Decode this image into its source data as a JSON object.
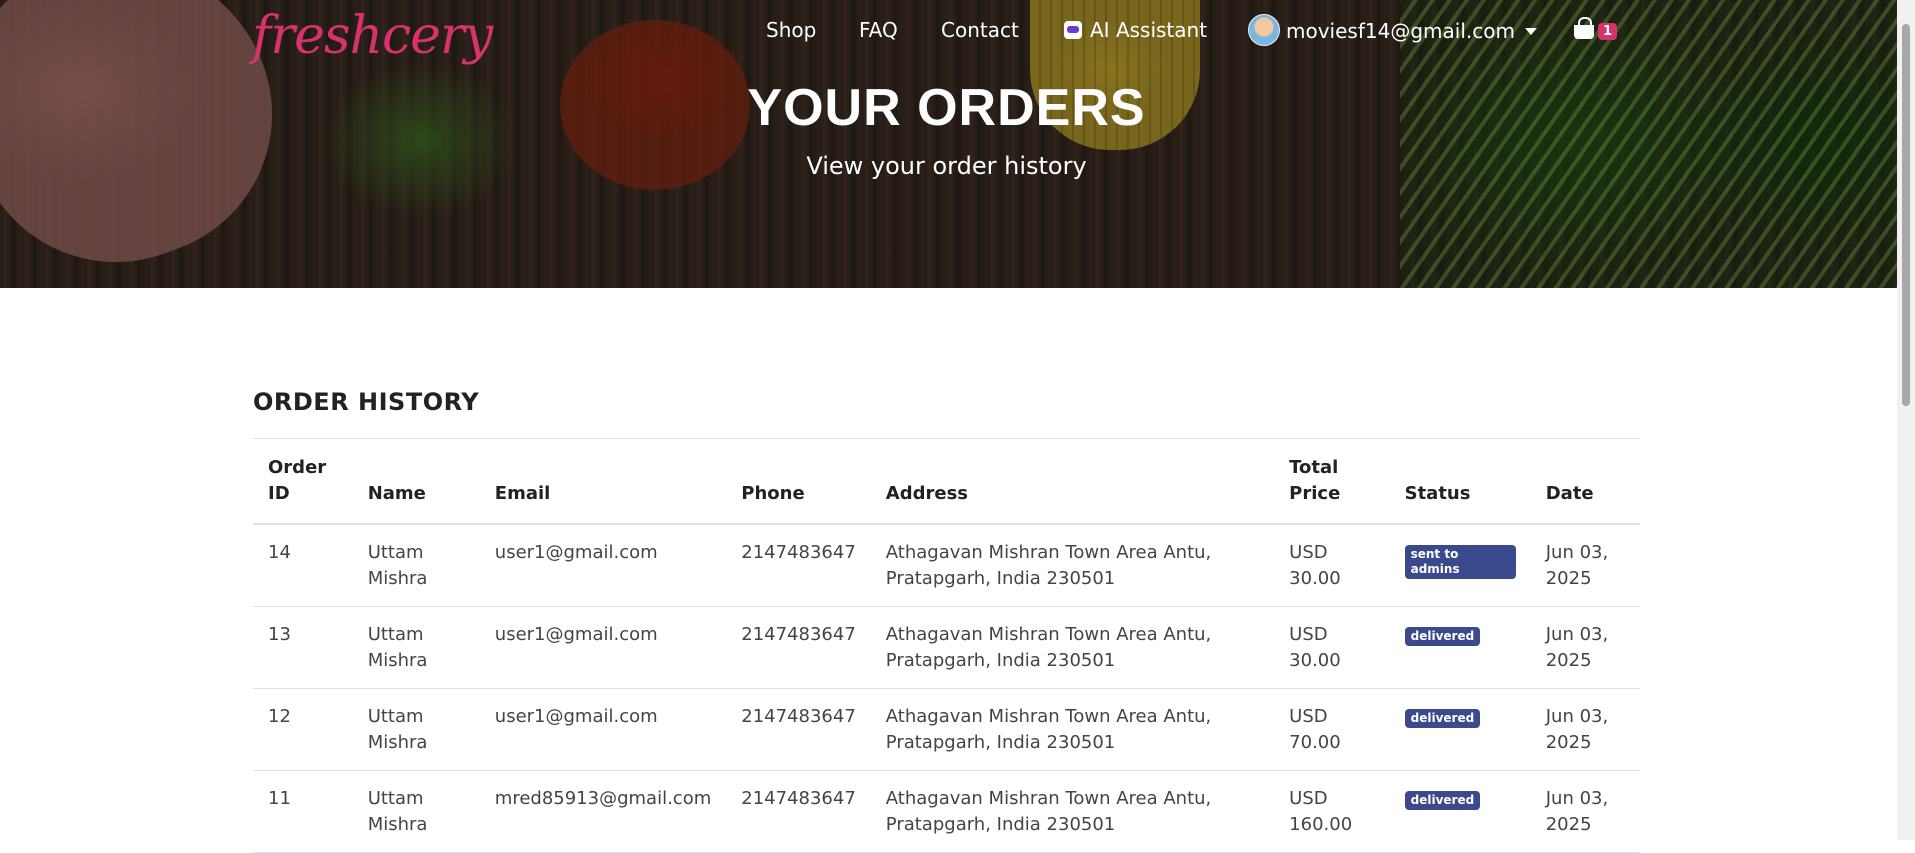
{
  "brand": {
    "logo_text": "freshcery"
  },
  "nav": {
    "shop": "Shop",
    "faq": "FAQ",
    "contact": "Contact",
    "ai_assistant": "AI Assistant",
    "user_email": "moviesf14@gmail.com",
    "cart_count": "1"
  },
  "hero": {
    "title": "YOUR ORDERS",
    "subtitle": "View your order history"
  },
  "orders": {
    "section_title": "ORDER HISTORY",
    "columns": {
      "order_id": "Order ID",
      "name": "Name",
      "email": "Email",
      "phone": "Phone",
      "address": "Address",
      "total_price": "Total Price",
      "status": "Status",
      "date": "Date"
    },
    "rows": [
      {
        "id": "14",
        "name": "Uttam Mishra",
        "email": "user1@gmail.com",
        "phone": "2147483647",
        "address": "Athagavan Mishran Town Area Antu, Pratapgarh, India 230501",
        "price": "USD 30.00",
        "status": "sent to admins",
        "date": "Jun 03, 2025"
      },
      {
        "id": "13",
        "name": "Uttam Mishra",
        "email": "user1@gmail.com",
        "phone": "2147483647",
        "address": "Athagavan Mishran Town Area Antu, Pratapgarh, India 230501",
        "price": "USD 30.00",
        "status": "delivered",
        "date": "Jun 03, 2025"
      },
      {
        "id": "12",
        "name": "Uttam Mishra",
        "email": "user1@gmail.com",
        "phone": "2147483647",
        "address": "Athagavan Mishran Town Area Antu, Pratapgarh, India 230501",
        "price": "USD 70.00",
        "status": "delivered",
        "date": "Jun 03, 2025"
      },
      {
        "id": "11",
        "name": "Uttam Mishra",
        "email": "mred85913@gmail.com",
        "phone": "2147483647",
        "address": "Athagavan Mishran Town Area Antu, Pratapgarh, India 230501",
        "price": "USD 160.00",
        "status": "delivered",
        "date": "Jun 03, 2025"
      }
    ]
  },
  "colors": {
    "brand_pink": "#d6336c",
    "status_badge": "#3b4a8c"
  },
  "icons": {
    "ai": "robot-icon",
    "cart": "shopping-basket-icon",
    "dropdown": "caret-down-icon"
  }
}
